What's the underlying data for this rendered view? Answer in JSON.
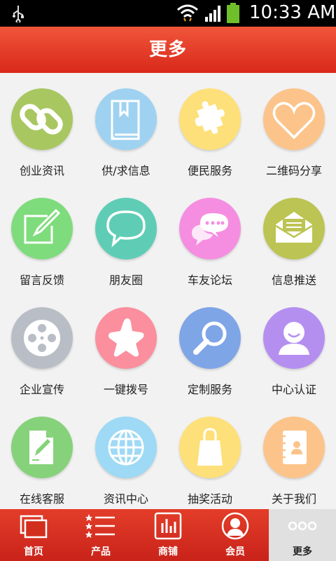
{
  "status_bar": {
    "time": "10:33 AM"
  },
  "header": {
    "title": "更多"
  },
  "grid": {
    "items": [
      {
        "label": "创业资讯",
        "icon": "link-icon",
        "color": "#a8c761"
      },
      {
        "label": "供/求信息",
        "icon": "book-icon",
        "color": "#9ed2f0"
      },
      {
        "label": "便民服务",
        "icon": "puzzle-icon",
        "color": "#fde07a"
      },
      {
        "label": "二维码分享",
        "icon": "heart-icon",
        "color": "#fcc48a"
      },
      {
        "label": "留言反馈",
        "icon": "edit-icon",
        "color": "#7fdc7c"
      },
      {
        "label": "朋友圈",
        "icon": "chat-bubble-icon",
        "color": "#5fcdb5"
      },
      {
        "label": "车友论坛",
        "icon": "chat-dots-icon",
        "color": "#f58ee0"
      },
      {
        "label": "信息推送",
        "icon": "envelope-icon",
        "color": "#bcc453"
      },
      {
        "label": "企业宣传",
        "icon": "film-reel-icon",
        "color": "#b9bec6"
      },
      {
        "label": "一键拨号",
        "icon": "star-icon",
        "color": "#fb8f9d"
      },
      {
        "label": "定制服务",
        "icon": "magnifier-icon",
        "color": "#7ea5e6"
      },
      {
        "label": "中心认证",
        "icon": "user-icon",
        "color": "#b48ff0"
      },
      {
        "label": "在线客服",
        "icon": "document-edit-icon",
        "color": "#86d27a"
      },
      {
        "label": "资讯中心",
        "icon": "globe-icon",
        "color": "#9ed9f5"
      },
      {
        "label": "抽奖活动",
        "icon": "shopping-bag-icon",
        "color": "#fde07a"
      },
      {
        "label": "关于我们",
        "icon": "contact-book-icon",
        "color": "#fcc48a"
      }
    ]
  },
  "bottom_nav": {
    "items": [
      {
        "label": "首页",
        "icon": "home-windows-icon"
      },
      {
        "label": "产品",
        "icon": "star-list-icon"
      },
      {
        "label": "商铺",
        "icon": "chart-shop-icon"
      },
      {
        "label": "会员",
        "icon": "member-icon"
      },
      {
        "label": "更多",
        "icon": "more-dots-icon",
        "active": true
      }
    ]
  },
  "colors": {
    "header_red": "#e23b26",
    "grid_bg": "#f2f2f2",
    "active_tab": "#e0e0e0"
  }
}
